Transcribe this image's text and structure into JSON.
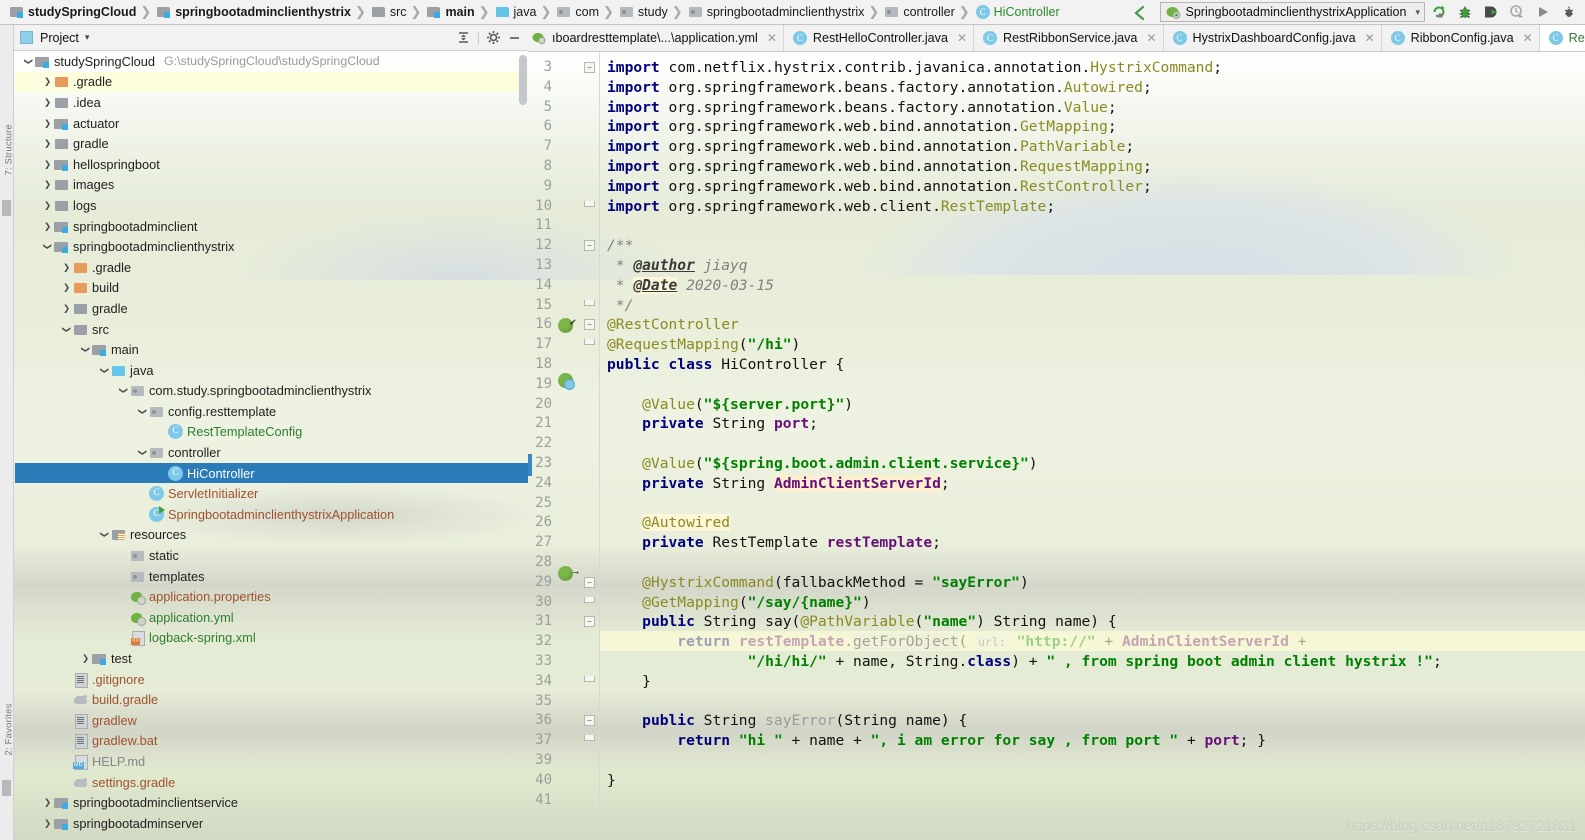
{
  "breadcrumb": {
    "items": [
      {
        "label": "studySpringCloud",
        "icon": "module-folder-icon",
        "bold": true,
        "style": "module"
      },
      {
        "label": "springbootadminclienthystrix",
        "icon": "module-folder-icon",
        "bold": true,
        "style": "module"
      },
      {
        "label": "src",
        "icon": "folder-icon",
        "bold": false,
        "style": "folder"
      },
      {
        "label": "main",
        "icon": "module-folder-icon",
        "bold": true,
        "style": "module"
      },
      {
        "label": "java",
        "icon": "source-folder-icon",
        "bold": false,
        "style": "folder-blue"
      },
      {
        "label": "com",
        "icon": "package-icon",
        "bold": false,
        "style": "package"
      },
      {
        "label": "study",
        "icon": "package-icon",
        "bold": false,
        "style": "package"
      },
      {
        "label": "springbootadminclienthystrix",
        "icon": "package-icon",
        "bold": false,
        "style": "package"
      },
      {
        "label": "controller",
        "icon": "package-icon",
        "bold": false,
        "style": "package"
      },
      {
        "label": "HiController",
        "icon": "class-icon",
        "bold": false,
        "style": "class-green"
      }
    ],
    "separator": "❯"
  },
  "toolbar": {
    "back_arrow": "back-arrow-icon",
    "run_config": "SpringbootadminclienthystrixApplication",
    "run_config_chevron": "▾",
    "buttons": [
      {
        "name": "rerun-button",
        "glyph": "rerun"
      },
      {
        "name": "debug-button",
        "glyph": "debug"
      },
      {
        "name": "run-with-coverage-button",
        "glyph": "coverage"
      },
      {
        "name": "profile-button",
        "glyph": "profile"
      },
      {
        "name": "run-button",
        "glyph": "play"
      },
      {
        "name": "more-button",
        "glyph": "more"
      }
    ]
  },
  "project_panel": {
    "title": "Project",
    "title_chevron": "▾",
    "collapse_all_icon": "collapse-all-icon",
    "settings_icon": "gear-icon",
    "hide_icon": "minimize-icon",
    "left_strip_labels": [
      "7: Structure",
      "2: Favorites"
    ]
  },
  "tree": [
    {
      "depth": 0,
      "label": "studySpringCloud",
      "path": "G:\\studySpringCloud\\studySpringCloud",
      "arrow": "down",
      "icon": "module-folder-icon",
      "style": "mod",
      "color": "plain",
      "selected": false,
      "highlight": false
    },
    {
      "depth": 1,
      "label": ".gradle",
      "path": "",
      "arrow": "right",
      "icon": "folder-icon",
      "style": "dir-or",
      "color": "plain",
      "selected": false,
      "highlight": true
    },
    {
      "depth": 1,
      "label": ".idea",
      "path": "",
      "arrow": "right",
      "icon": "folder-icon",
      "style": "dir",
      "color": "plain",
      "selected": false,
      "highlight": false
    },
    {
      "depth": 1,
      "label": "actuator",
      "path": "",
      "arrow": "right",
      "icon": "module-folder-icon",
      "style": "mod",
      "color": "plain",
      "selected": false,
      "highlight": false
    },
    {
      "depth": 1,
      "label": "gradle",
      "path": "",
      "arrow": "right",
      "icon": "folder-icon",
      "style": "dir",
      "color": "plain",
      "selected": false,
      "highlight": false
    },
    {
      "depth": 1,
      "label": "hellospringboot",
      "path": "",
      "arrow": "right",
      "icon": "module-folder-icon",
      "style": "mod",
      "color": "plain",
      "selected": false,
      "highlight": false
    },
    {
      "depth": 1,
      "label": "images",
      "path": "",
      "arrow": "right",
      "icon": "folder-icon",
      "style": "dir",
      "color": "plain",
      "selected": false,
      "highlight": false
    },
    {
      "depth": 1,
      "label": "logs",
      "path": "",
      "arrow": "right",
      "icon": "folder-icon",
      "style": "dir",
      "color": "plain",
      "selected": false,
      "highlight": false
    },
    {
      "depth": 1,
      "label": "springbootadminclient",
      "path": "",
      "arrow": "right",
      "icon": "module-folder-icon",
      "style": "mod",
      "color": "plain",
      "selected": false,
      "highlight": false
    },
    {
      "depth": 1,
      "label": "springbootadminclienthystrix",
      "path": "",
      "arrow": "down",
      "icon": "module-folder-icon",
      "style": "mod",
      "color": "plain",
      "selected": false,
      "highlight": false
    },
    {
      "depth": 2,
      "label": ".gradle",
      "path": "",
      "arrow": "right",
      "icon": "folder-icon",
      "style": "dir-or",
      "color": "plain",
      "selected": false,
      "highlight": false
    },
    {
      "depth": 2,
      "label": "build",
      "path": "",
      "arrow": "right",
      "icon": "folder-icon",
      "style": "dir-or",
      "color": "plain",
      "selected": false,
      "highlight": false
    },
    {
      "depth": 2,
      "label": "gradle",
      "path": "",
      "arrow": "right",
      "icon": "folder-icon",
      "style": "dir",
      "color": "plain",
      "selected": false,
      "highlight": false
    },
    {
      "depth": 2,
      "label": "src",
      "path": "",
      "arrow": "down",
      "icon": "folder-icon",
      "style": "dir",
      "color": "plain",
      "selected": false,
      "highlight": false
    },
    {
      "depth": 3,
      "label": "main",
      "path": "",
      "arrow": "down",
      "icon": "module-folder-icon",
      "style": "mod",
      "color": "plain",
      "selected": false,
      "highlight": false
    },
    {
      "depth": 4,
      "label": "java",
      "path": "",
      "arrow": "down",
      "icon": "source-folder-icon",
      "style": "dir-bl",
      "color": "plain",
      "selected": false,
      "highlight": false
    },
    {
      "depth": 5,
      "label": "com.study.springbootadminclienthystrix",
      "path": "",
      "arrow": "down",
      "icon": "package-icon",
      "style": "pkg",
      "color": "plain",
      "selected": false,
      "highlight": false
    },
    {
      "depth": 6,
      "label": "config.resttemplate",
      "path": "",
      "arrow": "down",
      "icon": "package-icon",
      "style": "pkg",
      "color": "plain",
      "selected": false,
      "highlight": false
    },
    {
      "depth": 7,
      "label": "RestTemplateConfig",
      "path": "",
      "arrow": "none",
      "icon": "class-icon",
      "style": "cls",
      "color": "green",
      "selected": false,
      "highlight": false
    },
    {
      "depth": 6,
      "label": "controller",
      "path": "",
      "arrow": "down",
      "icon": "package-icon",
      "style": "pkg",
      "color": "plain",
      "selected": false,
      "highlight": false
    },
    {
      "depth": 7,
      "label": "HiController",
      "path": "",
      "arrow": "none",
      "icon": "class-icon",
      "style": "cls",
      "color": "plain",
      "selected": true,
      "highlight": false
    },
    {
      "depth": 6,
      "label": "ServletInitializer",
      "path": "",
      "arrow": "none",
      "icon": "class-icon",
      "style": "cls",
      "color": "brown",
      "selected": false,
      "highlight": false
    },
    {
      "depth": 6,
      "label": "SpringbootadminclienthystrixApplication",
      "path": "",
      "arrow": "none",
      "icon": "runnable-class-icon",
      "style": "cls-run",
      "color": "brown",
      "selected": false,
      "highlight": false
    },
    {
      "depth": 4,
      "label": "resources",
      "path": "",
      "arrow": "down",
      "icon": "resource-folder-icon",
      "style": "res",
      "color": "plain",
      "selected": false,
      "highlight": false
    },
    {
      "depth": 5,
      "label": "static",
      "path": "",
      "arrow": "none",
      "icon": "package-icon",
      "style": "pkg",
      "color": "plain",
      "selected": false,
      "highlight": false
    },
    {
      "depth": 5,
      "label": "templates",
      "path": "",
      "arrow": "none",
      "icon": "package-icon",
      "style": "pkg",
      "color": "plain",
      "selected": false,
      "highlight": false
    },
    {
      "depth": 5,
      "label": "application.properties",
      "path": "",
      "arrow": "none",
      "icon": "spring-file-icon",
      "style": "spring",
      "color": "brown",
      "selected": false,
      "highlight": false
    },
    {
      "depth": 5,
      "label": "application.yml",
      "path": "",
      "arrow": "none",
      "icon": "spring-file-icon",
      "style": "spring",
      "color": "green",
      "selected": false,
      "highlight": false
    },
    {
      "depth": 5,
      "label": "logback-spring.xml",
      "path": "",
      "arrow": "none",
      "icon": "xml-file-icon",
      "style": "xml",
      "color": "green",
      "selected": false,
      "highlight": false
    },
    {
      "depth": 3,
      "label": "test",
      "path": "",
      "arrow": "right",
      "icon": "module-folder-icon",
      "style": "mod",
      "color": "plain",
      "selected": false,
      "highlight": false
    },
    {
      "depth": 2,
      "label": ".gitignore",
      "path": "",
      "arrow": "none",
      "icon": "file-icon",
      "style": "leaf",
      "color": "brown",
      "selected": false,
      "highlight": false
    },
    {
      "depth": 2,
      "label": "build.gradle",
      "path": "",
      "arrow": "none",
      "icon": "gradle-file-icon",
      "style": "gradle",
      "color": "brown",
      "selected": false,
      "highlight": false
    },
    {
      "depth": 2,
      "label": "gradlew",
      "path": "",
      "arrow": "none",
      "icon": "file-icon",
      "style": "leaf",
      "color": "brown",
      "selected": false,
      "highlight": false
    },
    {
      "depth": 2,
      "label": "gradlew.bat",
      "path": "",
      "arrow": "none",
      "icon": "file-icon",
      "style": "leaf",
      "color": "brown",
      "selected": false,
      "highlight": false
    },
    {
      "depth": 2,
      "label": "HELP.md",
      "path": "",
      "arrow": "none",
      "icon": "markdown-file-icon",
      "style": "md",
      "color": "grayed",
      "selected": false,
      "highlight": false
    },
    {
      "depth": 2,
      "label": "settings.gradle",
      "path": "",
      "arrow": "none",
      "icon": "gradle-file-icon",
      "style": "gradle",
      "color": "brown",
      "selected": false,
      "highlight": false
    },
    {
      "depth": 1,
      "label": "springbootadminclientservice",
      "path": "",
      "arrow": "right",
      "icon": "module-folder-icon",
      "style": "mod",
      "color": "plain",
      "selected": false,
      "highlight": false
    },
    {
      "depth": 1,
      "label": "springbootadminserver",
      "path": "",
      "arrow": "right",
      "icon": "module-folder-icon",
      "style": "mod",
      "color": "plain",
      "selected": false,
      "highlight": false
    }
  ],
  "editor_tabs": [
    {
      "label": "ıboardresttemplate\\...\\application.yml",
      "icon": "spring-file-icon",
      "active": false,
      "clipped": true,
      "close": "✕"
    },
    {
      "label": "RestHelloController.java",
      "icon": "class-icon",
      "active": false,
      "clipped": false,
      "close": "✕"
    },
    {
      "label": "RestRibbonService.java",
      "icon": "class-icon",
      "active": false,
      "clipped": false,
      "close": "✕"
    },
    {
      "label": "HystrixDashboardConfig.java",
      "icon": "class-icon",
      "active": false,
      "clipped": false,
      "close": "✕"
    },
    {
      "label": "RibbonConfig.java",
      "icon": "class-icon",
      "active": false,
      "clipped": false,
      "close": "✕"
    },
    {
      "label": "RestTe",
      "icon": "class-icon",
      "active": true,
      "clipped": false,
      "close": ""
    }
  ],
  "code": {
    "first_visible_line": 3,
    "lines": [
      {
        "n": 3,
        "text": "import com.netflix.hystrix.contrib.javanica.annotation.HystrixCommand;"
      },
      {
        "n": 4,
        "text": "import org.springframework.beans.factory.annotation.Autowired;"
      },
      {
        "n": 5,
        "text": "import org.springframework.beans.factory.annotation.Value;"
      },
      {
        "n": 6,
        "text": "import org.springframework.web.bind.annotation.GetMapping;"
      },
      {
        "n": 7,
        "text": "import org.springframework.web.bind.annotation.PathVariable;"
      },
      {
        "n": 8,
        "text": "import org.springframework.web.bind.annotation.RequestMapping;"
      },
      {
        "n": 9,
        "text": "import org.springframework.web.bind.annotation.RestController;"
      },
      {
        "n": 10,
        "text": "import org.springframework.web.client.RestTemplate;"
      },
      {
        "n": 11,
        "text": ""
      },
      {
        "n": 12,
        "text": "/**"
      },
      {
        "n": 13,
        "text": " * @author jiayq"
      },
      {
        "n": 14,
        "text": " * @Date 2020-03-15"
      },
      {
        "n": 15,
        "text": " */"
      },
      {
        "n": 16,
        "text": "@RestController"
      },
      {
        "n": 17,
        "text": "@RequestMapping(\"/hi\")"
      },
      {
        "n": 18,
        "text": "public class HiController {"
      },
      {
        "n": 19,
        "text": ""
      },
      {
        "n": 20,
        "text": "    @Value(\"${server.port}\")"
      },
      {
        "n": 21,
        "text": "    private String port;"
      },
      {
        "n": 22,
        "text": ""
      },
      {
        "n": 23,
        "text": "    @Value(\"${spring.boot.admin.client.service}\")"
      },
      {
        "n": 24,
        "text": "    private String AdminClientServerId;"
      },
      {
        "n": 25,
        "text": ""
      },
      {
        "n": 26,
        "text": "    @Autowired"
      },
      {
        "n": 27,
        "text": "    private RestTemplate restTemplate;"
      },
      {
        "n": 28,
        "text": ""
      },
      {
        "n": 29,
        "text": "    @HystrixCommand(fallbackMethod = \"sayError\")"
      },
      {
        "n": 30,
        "text": "    @GetMapping(\"/say/{name}\")"
      },
      {
        "n": 31,
        "text": "    public String say(@PathVariable(\"name\") String name) {"
      },
      {
        "n": 32,
        "text": "        return restTemplate.getForObject( url: \"http://\" + AdminClientServerId +"
      },
      {
        "n": 33,
        "text": "                \"/hi/hi/\" + name, String.class) + \" , from spring boot admin client hystrix !\";"
      },
      {
        "n": 34,
        "text": "    }"
      },
      {
        "n": 35,
        "text": ""
      },
      {
        "n": 36,
        "text": "    public String sayError(String name) {"
      },
      {
        "n": 37,
        "text": "        return \"hi \" + name + \", i am error for say , from port \" + port; }"
      },
      {
        "n": 39,
        "text": ""
      },
      {
        "n": 40,
        "text": "}"
      },
      {
        "n": 41,
        "text": ""
      }
    ],
    "highlighted_line": 32,
    "parameter_hint": "url:"
  },
  "watermark": "https://blog.csdn.net/a18792721831",
  "colors": {
    "selection_blue": "#2a7cb8",
    "keyword_navy": "#00007f",
    "string_green": "#008000",
    "annotation_olive": "#8a8a20",
    "field_purple": "#660e7a",
    "comment_gray": "#808080",
    "spring_green": "#6db33f",
    "class_icon_blue": "#7ec8e8"
  }
}
